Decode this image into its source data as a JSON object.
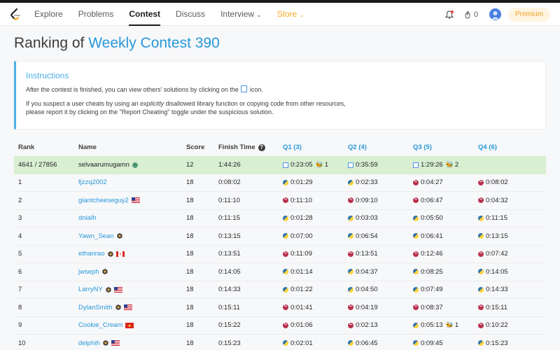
{
  "nav": {
    "links": [
      {
        "label": "Explore"
      },
      {
        "label": "Problems"
      },
      {
        "label": "Contest"
      },
      {
        "label": "Discuss"
      },
      {
        "label": "Interview"
      },
      {
        "label": "Store"
      }
    ],
    "streak_count": "0",
    "premium_label": "Premium"
  },
  "page": {
    "title_prefix": "Ranking of ",
    "contest_name": "Weekly Contest 390"
  },
  "instructions": {
    "heading": "Instructions",
    "line1_before": "After the contest is finished, you can view others' solutions by clicking on the",
    "line1_after": "icon.",
    "line2_before": "If you suspect a user cheats by using an ",
    "line2_emph": "explicitly",
    "line2_after": " disallowed library function or copying code from other resources,",
    "line3": "please report it by clicking on the \"Report Cheating\" toggle under the suspicious solution."
  },
  "table": {
    "headers": {
      "rank": "Rank",
      "name": "Name",
      "score": "Score",
      "finish_time": "Finish Time",
      "q1": "Q1 (3)",
      "q2": "Q2 (4)",
      "q3": "Q3 (5)",
      "q4": "Q4 (6)"
    },
    "rows": [
      {
        "rank": "4641 / 27856",
        "name": "selvaarumugamn",
        "score": "12",
        "time": "1:44:26",
        "q1": "0:23:05",
        "q1_lang": "doc",
        "q1_bugs": "1",
        "q2": "0:35:59",
        "q2_lang": "doc",
        "q2_bugs": "",
        "q3": "1:29:26",
        "q3_lang": "doc",
        "q3_bugs": "2",
        "q4": "",
        "q4_lang": "",
        "q4_bugs": ""
      },
      {
        "rank": "1",
        "name": "fjzzq2002",
        "score": "18",
        "time": "0:08:02",
        "q1": "0:01:29",
        "q1_lang": "py",
        "q1_bugs": "",
        "q2": "0:02:33",
        "q2_lang": "py",
        "q2_bugs": "",
        "q3": "0:04:27",
        "q3_lang": "cpp",
        "q3_bugs": "",
        "q4": "0:08:02",
        "q4_lang": "cpp",
        "q4_bugs": ""
      },
      {
        "rank": "2",
        "name": "giantcheeseguy2",
        "score": "18",
        "time": "0:11:10",
        "q1": "0:11:10",
        "q1_lang": "cpp",
        "q1_bugs": "",
        "q2": "0:09:10",
        "q2_lang": "cpp",
        "q2_bugs": "",
        "q3": "0:06:47",
        "q3_lang": "cpp",
        "q3_bugs": "",
        "q4": "0:04:32",
        "q4_lang": "cpp",
        "q4_bugs": ""
      },
      {
        "rank": "3",
        "name": "dnialh",
        "score": "18",
        "time": "0:11:15",
        "q1": "0:01:28",
        "q1_lang": "py",
        "q1_bugs": "",
        "q2": "0:03:03",
        "q2_lang": "py",
        "q2_bugs": "",
        "q3": "0:05:50",
        "q3_lang": "py",
        "q3_bugs": "",
        "q4": "0:11:15",
        "q4_lang": "py",
        "q4_bugs": ""
      },
      {
        "rank": "4",
        "name": "Yawn_Sean",
        "score": "18",
        "time": "0:13:15",
        "q1": "0:07:00",
        "q1_lang": "py",
        "q1_bugs": "",
        "q2": "0:06:54",
        "q2_lang": "py",
        "q2_bugs": "",
        "q3": "0:06:41",
        "q3_lang": "py",
        "q3_bugs": "",
        "q4": "0:13:15",
        "q4_lang": "py",
        "q4_bugs": ""
      },
      {
        "rank": "5",
        "name": "ethanrao",
        "score": "18",
        "time": "0:13:51",
        "q1": "0:11:09",
        "q1_lang": "cpp",
        "q1_bugs": "",
        "q2": "0:13:51",
        "q2_lang": "cpp",
        "q2_bugs": "",
        "q3": "0:12:46",
        "q3_lang": "cpp",
        "q3_bugs": "",
        "q4": "0:07:42",
        "q4_lang": "cpp",
        "q4_bugs": ""
      },
      {
        "rank": "6",
        "name": "jwseph",
        "score": "18",
        "time": "0:14:05",
        "q1": "0:01:14",
        "q1_lang": "py",
        "q1_bugs": "",
        "q2": "0:04:37",
        "q2_lang": "py",
        "q2_bugs": "",
        "q3": "0:08:25",
        "q3_lang": "py",
        "q3_bugs": "",
        "q4": "0:14:05",
        "q4_lang": "py",
        "q4_bugs": ""
      },
      {
        "rank": "7",
        "name": "LarryNY",
        "score": "18",
        "time": "0:14:33",
        "q1": "0:01:22",
        "q1_lang": "py",
        "q1_bugs": "",
        "q2": "0:04:50",
        "q2_lang": "py",
        "q2_bugs": "",
        "q3": "0:07:49",
        "q3_lang": "py",
        "q3_bugs": "",
        "q4": "0:14:33",
        "q4_lang": "py",
        "q4_bugs": ""
      },
      {
        "rank": "8",
        "name": "DylanSmith",
        "score": "18",
        "time": "0:15:11",
        "q1": "0:01:41",
        "q1_lang": "cpp",
        "q1_bugs": "",
        "q2": "0:04:19",
        "q2_lang": "cpp",
        "q2_bugs": "",
        "q3": "0:08:37",
        "q3_lang": "cpp",
        "q3_bugs": "",
        "q4": "0:15:11",
        "q4_lang": "cpp",
        "q4_bugs": ""
      },
      {
        "rank": "9",
        "name": "Cookie_Cream",
        "score": "18",
        "time": "0:15:22",
        "q1": "0:01:06",
        "q1_lang": "cpp",
        "q1_bugs": "",
        "q2": "0:02:13",
        "q2_lang": "cpp",
        "q2_bugs": "",
        "q3": "0:05:13",
        "q3_lang": "py",
        "q3_bugs": "1",
        "q4": "0:10:22",
        "q4_lang": "cpp",
        "q4_bugs": ""
      },
      {
        "rank": "10",
        "name": "delphih",
        "score": "18",
        "time": "0:15:23",
        "q1": "0:02:01",
        "q1_lang": "py",
        "q1_bugs": "",
        "q2": "0:06:45",
        "q2_lang": "py",
        "q2_bugs": "",
        "q3": "0:09:45",
        "q3_lang": "py",
        "q3_bugs": "",
        "q4": "0:15:23",
        "q4_lang": "py",
        "q4_bugs": ""
      }
    ]
  },
  "colors": {
    "accent_blue": "#2997d8",
    "highlight_row": "#d8efd2",
    "store_orange": "#f5a623"
  }
}
